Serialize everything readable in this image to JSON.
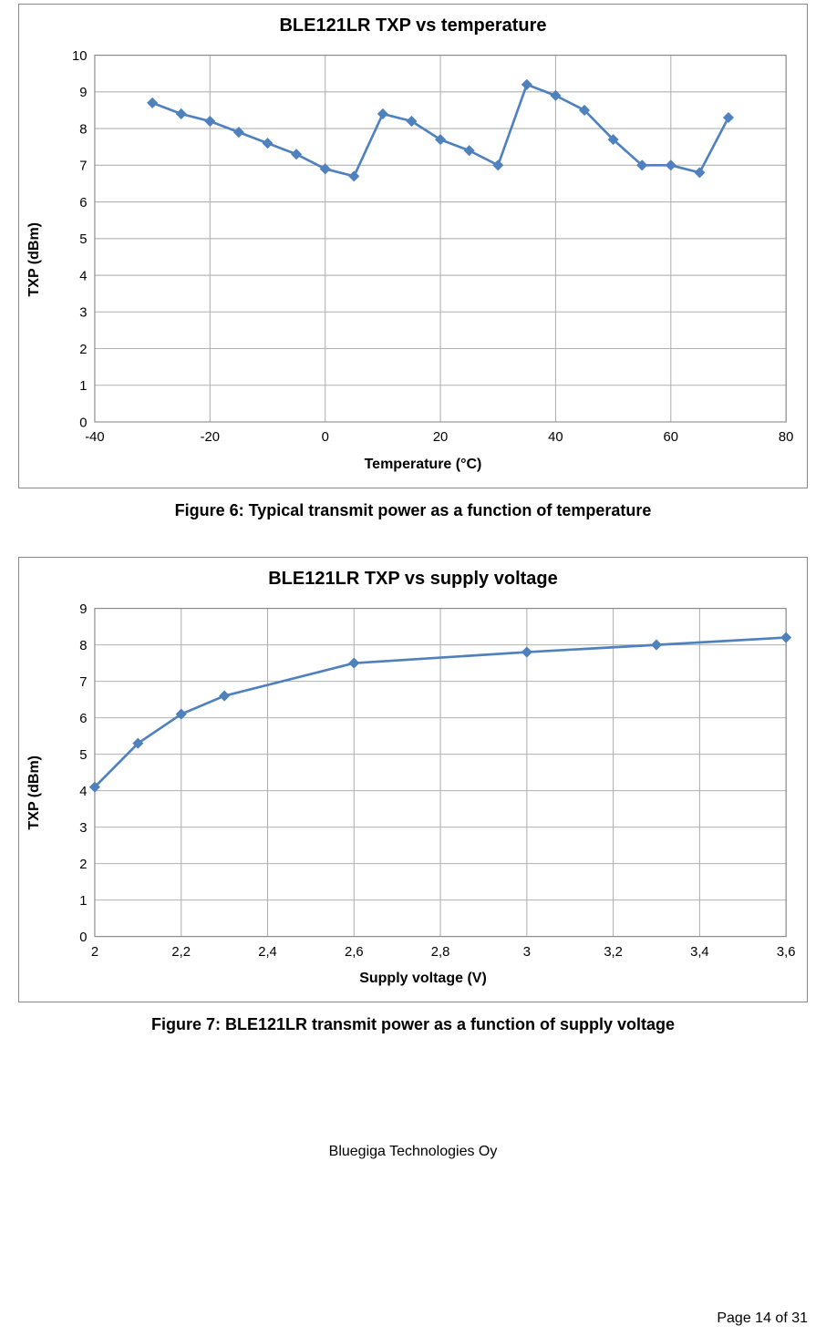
{
  "chart_data": [
    {
      "type": "line",
      "name": "chart1",
      "title": "BLE121LR TXP vs temperature",
      "xlabel": "Temperature (°C)",
      "ylabel": "TXP (dBm)",
      "xlim": [
        -40,
        80
      ],
      "ylim": [
        0,
        10
      ],
      "xticks": [
        -40,
        -20,
        0,
        20,
        40,
        60,
        80
      ],
      "yticks": [
        0,
        1,
        2,
        3,
        4,
        5,
        6,
        7,
        8,
        9,
        10
      ],
      "x": [
        -30,
        -25,
        -20,
        -15,
        -10,
        -5,
        0,
        5,
        10,
        15,
        20,
        25,
        30,
        35,
        40,
        45,
        50,
        55,
        60,
        65,
        70
      ],
      "values": [
        8.7,
        8.4,
        8.2,
        7.9,
        7.6,
        7.3,
        6.9,
        6.7,
        8.4,
        8.2,
        7.7,
        7.4,
        7.0,
        9.2,
        8.9,
        8.5,
        7.7,
        7.0,
        7.0,
        6.8,
        8.3
      ],
      "caption": "Figure 6: Typical transmit power as a function of temperature"
    },
    {
      "type": "line",
      "name": "chart2",
      "title": "BLE121LR TXP vs supply voltage",
      "xlabel": "Supply voltage (V)",
      "ylabel": "TXP (dBm)",
      "xlim": [
        2.0,
        3.6
      ],
      "ylim": [
        0,
        9
      ],
      "xticks_labels": [
        "2",
        "2,2",
        "2,4",
        "2,6",
        "2,8",
        "3",
        "3,2",
        "3,4",
        "3,6"
      ],
      "xticks": [
        2.0,
        2.2,
        2.4,
        2.6,
        2.8,
        3.0,
        3.2,
        3.4,
        3.6
      ],
      "yticks": [
        0,
        1,
        2,
        3,
        4,
        5,
        6,
        7,
        8,
        9
      ],
      "x": [
        2.0,
        2.1,
        2.2,
        2.3,
        2.6,
        3.0,
        3.3,
        3.6
      ],
      "values": [
        4.1,
        5.3,
        6.1,
        6.6,
        7.5,
        7.8,
        8.0,
        8.2
      ],
      "caption": "Figure 7: BLE121LR transmit power as a function of supply voltage"
    }
  ],
  "footer": {
    "company": "Bluegiga Technologies Oy",
    "page": "Page 14 of 31"
  }
}
